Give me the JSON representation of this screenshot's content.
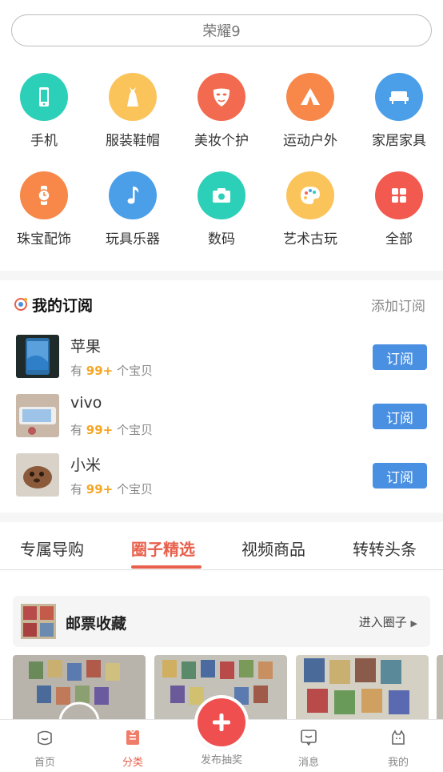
{
  "search": {
    "placeholder": "荣耀9"
  },
  "categories": [
    {
      "label": "手机",
      "icon": "phone-icon",
      "color": "#2ccfb8"
    },
    {
      "label": "服装鞋帽",
      "icon": "dress-icon",
      "color": "#fbc45b"
    },
    {
      "label": "美妆个护",
      "icon": "mask-icon",
      "color": "#f26a4f"
    },
    {
      "label": "运动户外",
      "icon": "tent-icon",
      "color": "#f7884a"
    },
    {
      "label": "家居家具",
      "icon": "sofa-icon",
      "color": "#4a9fe8"
    },
    {
      "label": "珠宝配饰",
      "icon": "watch-icon",
      "color": "#f7884a"
    },
    {
      "label": "玩具乐器",
      "icon": "music-note-icon",
      "color": "#4a9fe8"
    },
    {
      "label": "数码",
      "icon": "camera-icon",
      "color": "#2ccfb8"
    },
    {
      "label": "艺术古玩",
      "icon": "palette-icon",
      "color": "#fbc45b"
    },
    {
      "label": "全部",
      "icon": "grid-icon",
      "color": "#f2594f"
    }
  ],
  "subscriptions": {
    "title": "我的订阅",
    "add_label": "添加订阅",
    "items": [
      {
        "name": "苹果",
        "count_prefix": "有",
        "count": "99+",
        "count_suffix": "个宝贝",
        "button": "订阅"
      },
      {
        "name": "vivo",
        "count_prefix": "有",
        "count": "99+",
        "count_suffix": "个宝贝",
        "button": "订阅"
      },
      {
        "name": "小米",
        "count_prefix": "有",
        "count": "99+",
        "count_suffix": "个宝贝",
        "button": "订阅"
      }
    ]
  },
  "tabs": [
    {
      "label": "专属导购",
      "active": false
    },
    {
      "label": "圈子精选",
      "active": true
    },
    {
      "label": "视频商品",
      "active": false
    },
    {
      "label": "转转头条",
      "active": false
    }
  ],
  "circle": {
    "title": "邮票收藏",
    "enter_label": "进入圈子"
  },
  "bottom_nav": {
    "home": "首页",
    "category": "分类",
    "publish": "发布抽奖",
    "messages": "消息",
    "mine": "我的"
  },
  "colors": {
    "accent": "#e8604c",
    "subscribe_button": "#4a90e2",
    "count_highlight": "#f5a623"
  }
}
